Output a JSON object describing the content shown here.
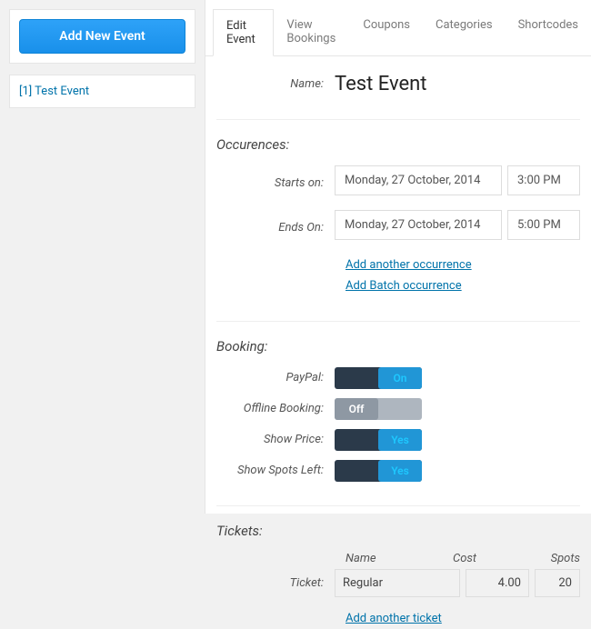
{
  "sidebar": {
    "add_button": "Add New Event",
    "event_item": "[1] Test Event"
  },
  "tabs": {
    "edit": "Edit Event",
    "bookings": "View Bookings",
    "coupons": "Coupons",
    "categories": "Categories",
    "shortcodes": "Shortcodes"
  },
  "name_label": "Name:",
  "event_name": "Test Event",
  "occurrences": {
    "heading": "Occurences:",
    "starts_label": "Starts on:",
    "ends_label": "Ends On:",
    "start_date": "Monday, 27 October, 2014",
    "start_time": "3:00 PM",
    "end_date": "Monday, 27 October, 2014",
    "end_time": "5:00 PM",
    "add_another": "Add another occurrence",
    "add_batch": "Add Batch occurrence"
  },
  "booking": {
    "heading": "Booking:",
    "paypal_label": "PayPal:",
    "paypal_value": "On",
    "offline_label": "Offline Booking:",
    "offline_value": "Off",
    "price_label": "Show Price:",
    "price_value": "Yes",
    "spots_label": "Show Spots Left:",
    "spots_value": "Yes"
  },
  "tickets": {
    "heading": "Tickets:",
    "col_name": "Name",
    "col_cost": "Cost",
    "col_spots": "Spots",
    "row_label": "Ticket:",
    "name": "Regular",
    "cost": "4.00",
    "spots": "20",
    "add_another": "Add another ticket"
  }
}
